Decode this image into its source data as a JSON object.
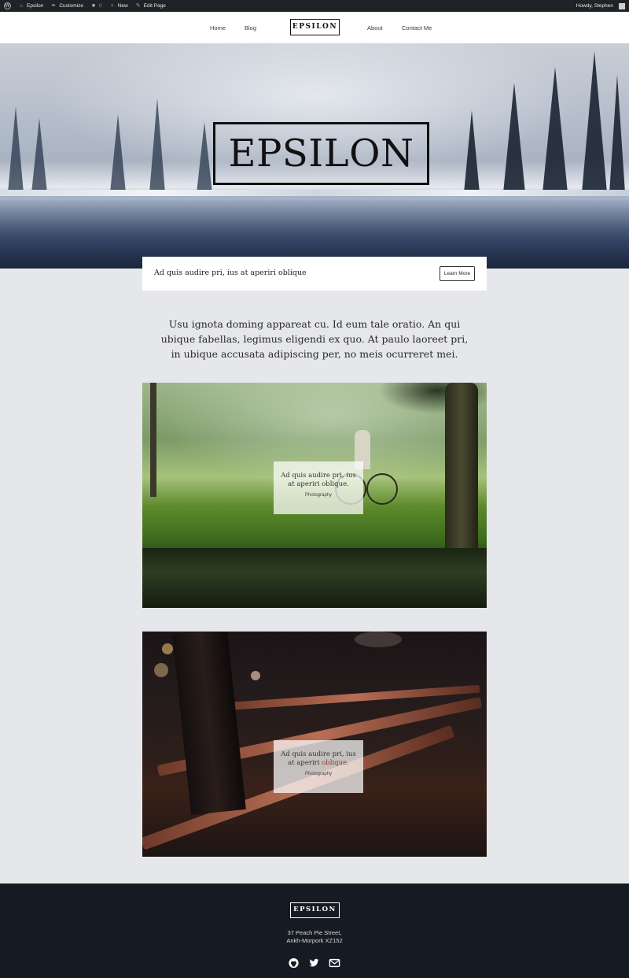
{
  "admin_bar": {
    "site_name": "Epsilon",
    "customize": "Customize",
    "comments_count": "0",
    "new": "New",
    "edit_page": "Edit Page",
    "greeting": "Howdy, Stephen"
  },
  "nav": {
    "items": [
      {
        "label": "Home"
      },
      {
        "label": "Blog"
      },
      {
        "label": "About"
      },
      {
        "label": "Contact Me"
      }
    ],
    "logo": "EPSILON"
  },
  "hero": {
    "logo": "EPSILON"
  },
  "banner": {
    "text": "Ad quis audire pri, ius at aperiri oblique",
    "button": "Learn More"
  },
  "intro": {
    "text": "Usu ignota doming appareat cu. Id eum tale oratio. An qui ubique fabellas, legimus eligendi ex quo. At paulo laoreet pri, in ubique accusata adipiscing per, no meis ocurreret mei."
  },
  "posts": [
    {
      "title": "Ad quis audire pri, ius at aperiri oblique.",
      "category": "Photography"
    },
    {
      "title_main": "Ad quis audire pri, ius at aperiri ",
      "title_accent": "oblique.",
      "category": "Photography"
    }
  ],
  "footer": {
    "logo": "EPSILON",
    "address_line1": "37 Peach Pie Street,",
    "address_line2": "Ankh-Morpork XZ152",
    "social": [
      "github-icon",
      "twitter-icon",
      "email-icon"
    ]
  },
  "colors": {
    "admin_bar": "#1f2327",
    "page_bg": "#e6e7ea",
    "footer_bg": "#161b23",
    "accent_link": "#8a3a30"
  }
}
